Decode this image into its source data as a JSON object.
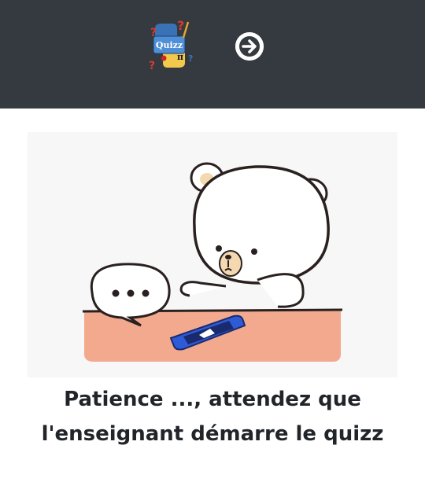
{
  "header": {
    "logo_label": "Quizz",
    "logo_symbol": "π",
    "logo_question_mark": "?",
    "next_icon": "arrow-right-circle-icon",
    "background_color": "#343a40"
  },
  "illustration": {
    "subject": "bear-waiting-phone-icon"
  },
  "message": {
    "line1": "Patience ..., attendez que",
    "line2": "l'enseignant démarre le quizz"
  }
}
